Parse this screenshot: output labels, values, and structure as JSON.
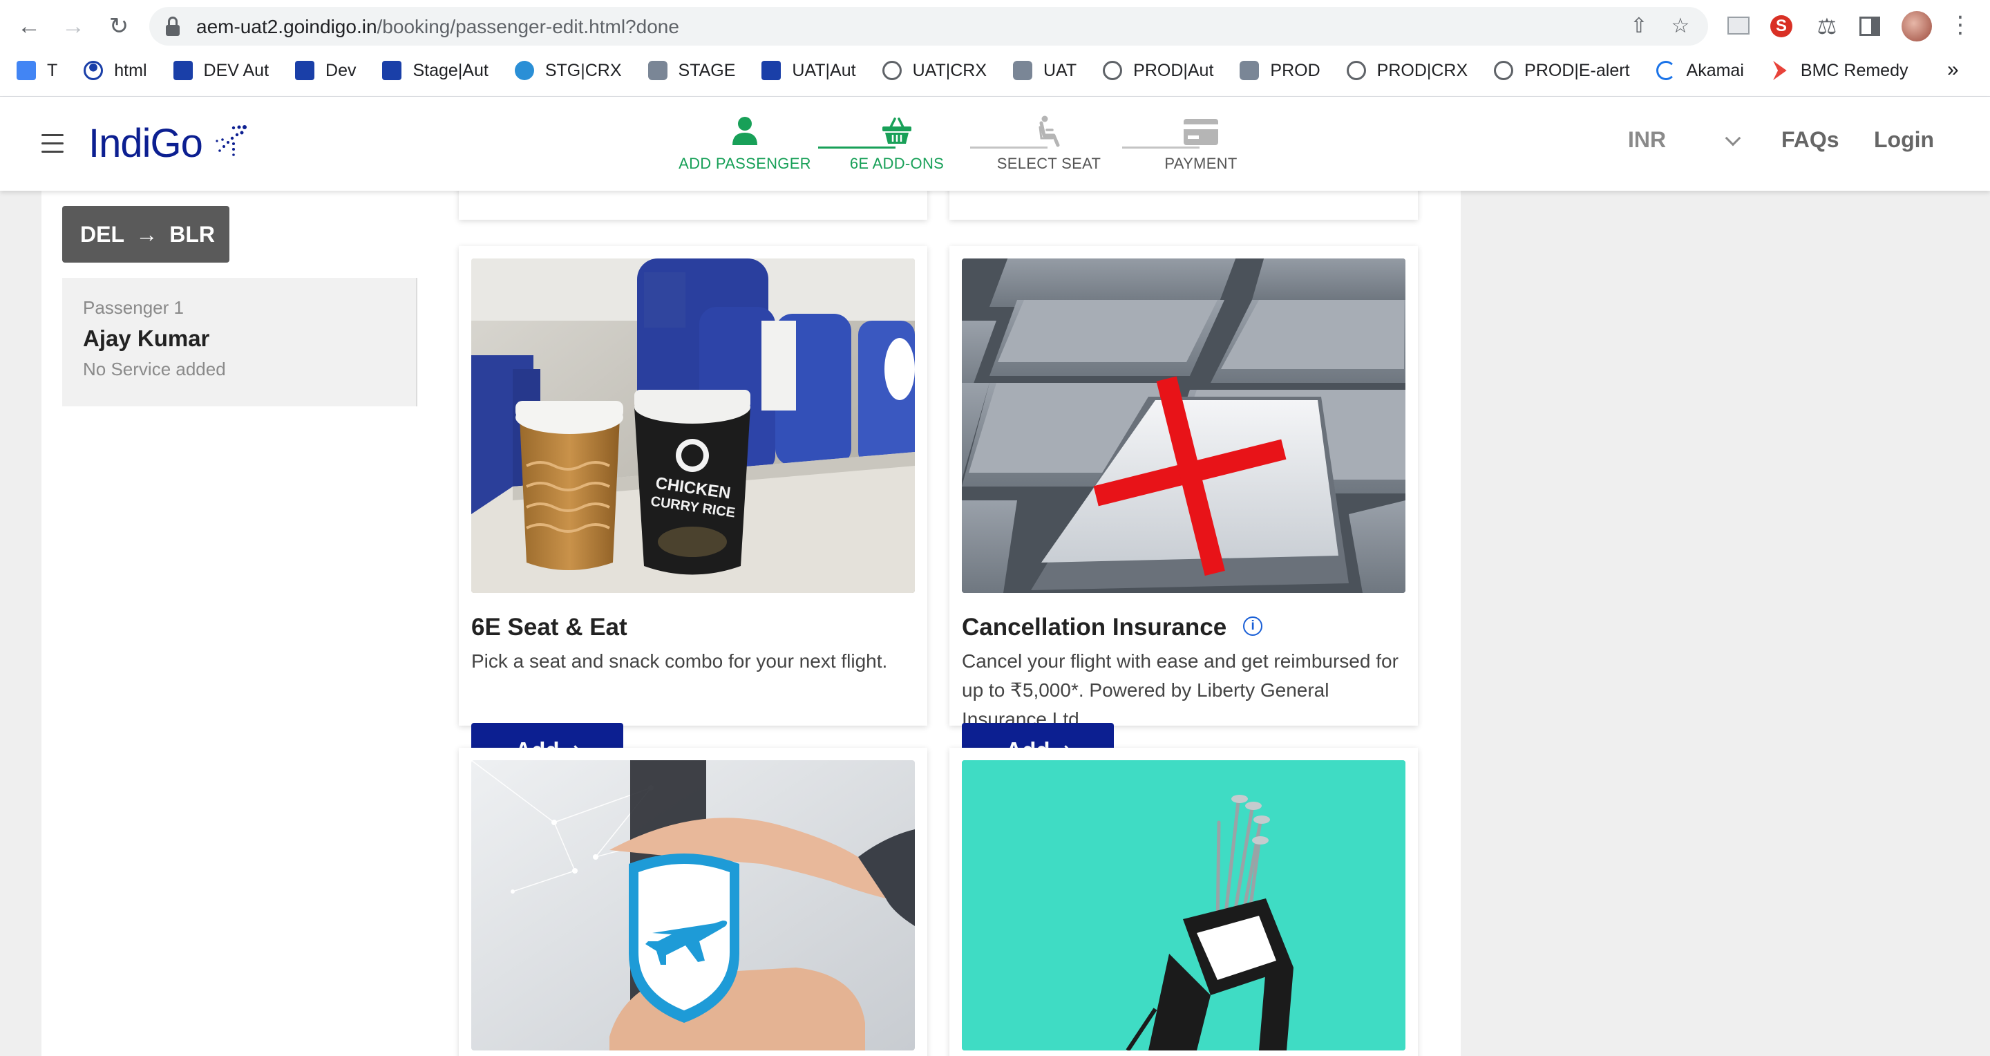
{
  "browser": {
    "url_host": "aem-uat2.goindigo.in",
    "url_path": "/booking/passenger-edit.html?done",
    "bookmarks": [
      {
        "label": "T",
        "icon": "google-translate-icon"
      },
      {
        "label": "html",
        "icon": "person-icon"
      },
      {
        "label": "DEV Aut",
        "icon": "plane-icon"
      },
      {
        "label": "Dev",
        "icon": "plane-icon"
      },
      {
        "label": "Stage|Aut",
        "icon": "plane-icon"
      },
      {
        "label": "STG|CRX",
        "icon": "cloud-icon"
      },
      {
        "label": "STAGE",
        "icon": "robot-icon"
      },
      {
        "label": "UAT|Aut",
        "icon": "plane-icon"
      },
      {
        "label": "UAT|CRX",
        "icon": "globe-icon"
      },
      {
        "label": "UAT",
        "icon": "robot-icon"
      },
      {
        "label": "PROD|Aut",
        "icon": "globe-icon"
      },
      {
        "label": "PROD",
        "icon": "robot-icon"
      },
      {
        "label": "PROD|CRX",
        "icon": "globe-icon"
      },
      {
        "label": "PROD|E-alert",
        "icon": "globe-icon"
      },
      {
        "label": "Akamai",
        "icon": "akamai-icon"
      },
      {
        "label": "BMC Remedy",
        "icon": "bmc-icon"
      }
    ],
    "more": "»"
  },
  "header": {
    "logo": "IndiGo",
    "steps": [
      {
        "label": "ADD PASSENGER",
        "state": "done",
        "icon": "person-icon"
      },
      {
        "label": "6E ADD-ONS",
        "state": "done",
        "icon": "basket-icon"
      },
      {
        "label": "SELECT SEAT",
        "state": "pending",
        "icon": "seat-icon"
      },
      {
        "label": "PAYMENT",
        "state": "pending",
        "icon": "card-icon"
      }
    ],
    "currency": "INR",
    "faqs": "FAQs",
    "login": "Login"
  },
  "sidebar": {
    "route_from": "DEL",
    "route_arrow": "→",
    "route_to": "BLR",
    "passenger_number": "Passenger 1",
    "passenger_name": "Ajay Kumar",
    "service_status": "No Service added"
  },
  "addons": [
    {
      "title": "6E Seat & Eat",
      "description": "Pick a seat and snack combo for your next flight.",
      "button": "Add"
    },
    {
      "title": "Cancellation Insurance",
      "description": "Cancel your flight with ease and get reimbursed for up to ₹5,000*. Powered by Liberty General Insurance Ltd.",
      "button": "Add",
      "info_icon": "i"
    }
  ],
  "colors": {
    "brand": "#0c1f91",
    "step_done": "#18a058",
    "step_pending": "#555555",
    "route_bg": "#5a5a5a",
    "golf_bg": "#3fdcc4"
  }
}
